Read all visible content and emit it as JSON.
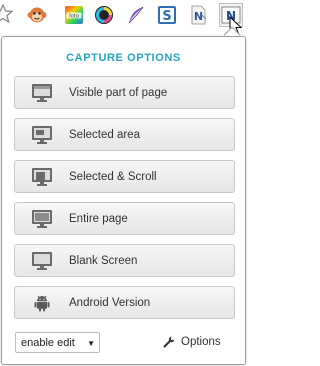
{
  "toolbar": {
    "icons": [
      "star-icon",
      "monkey-icon",
      "fotor-icon",
      "color-ring-icon",
      "feather-icon",
      "s-box-icon",
      "n-doc-icon",
      "nimbus-icon"
    ]
  },
  "popup": {
    "title": "CAPTURE OPTIONS",
    "options": [
      {
        "label": "Visible part of page",
        "icon": "monitor-visible-icon"
      },
      {
        "label": "Selected area",
        "icon": "monitor-selected-icon"
      },
      {
        "label": "Selected & Scroll",
        "icon": "monitor-scroll-icon"
      },
      {
        "label": "Entire page",
        "icon": "monitor-entire-icon"
      },
      {
        "label": "Blank Screen",
        "icon": "monitor-blank-icon"
      },
      {
        "label": "Android Version",
        "icon": "android-icon"
      }
    ],
    "select_value": "enable edit",
    "options_link": "Options"
  },
  "colors": {
    "accent": "#29a4be",
    "button_border": "#c9c9c9",
    "text": "#333333"
  }
}
